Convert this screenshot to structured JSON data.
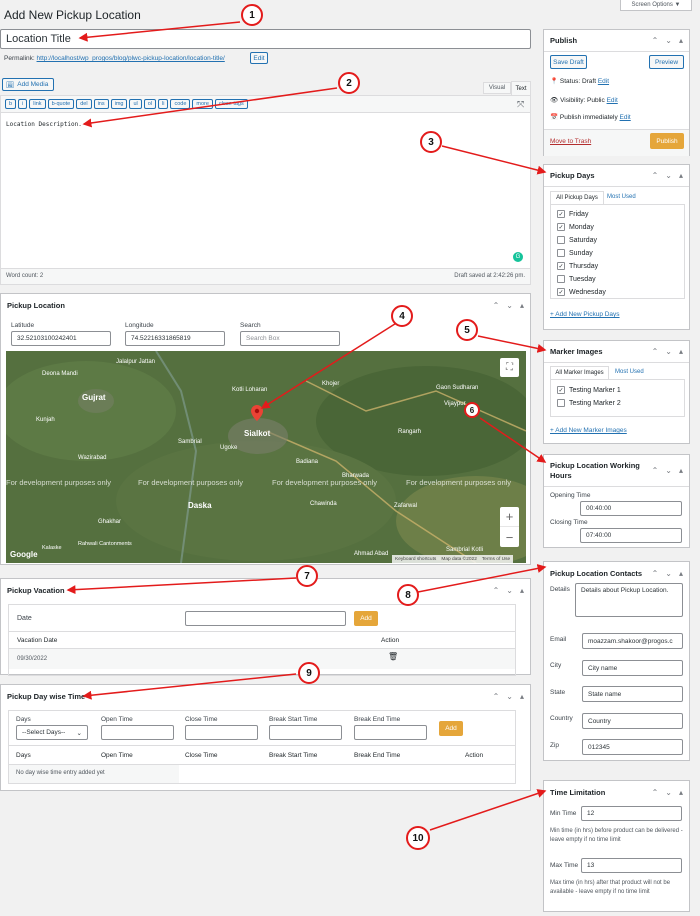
{
  "page": {
    "title": "Add New Pickup Location",
    "screen_options": "Screen Options ▼"
  },
  "editor": {
    "title_value": "Location Title",
    "permalink_label": "Permalink:",
    "permalink_url": "http://localhost/wp_progos/blog/plwc-pickup-location/location-title/",
    "permalink_edit": "Edit",
    "add_media": "Add Media",
    "tab_visual": "Visual",
    "tab_text": "Text",
    "quicktags": [
      "b",
      "i",
      "link",
      "b-quote",
      "del",
      "ins",
      "img",
      "ul",
      "ol",
      "li",
      "code",
      "more",
      "close tags"
    ],
    "content": "Location Description.",
    "word_count": "Word count: 2",
    "draft_saved": "Draft saved at 2:42:26 pm."
  },
  "publish": {
    "title": "Publish",
    "save_draft": "Save Draft",
    "preview": "Preview",
    "status": "Status: Draft",
    "status_edit": "Edit",
    "visibility": "Visibility: Public",
    "visibility_edit": "Edit",
    "publish_time": "Publish immediately",
    "publish_edit": "Edit",
    "trash": "Move to Trash",
    "publish_btn": "Publish"
  },
  "pickup_days": {
    "title": "Pickup Days",
    "tab_all": "All Pickup Days",
    "tab_used": "Most Used",
    "items": [
      {
        "label": "Friday",
        "checked": "✓"
      },
      {
        "label": "Monday",
        "checked": "✓"
      },
      {
        "label": "Saturday",
        "checked": ""
      },
      {
        "label": "Sunday",
        "checked": ""
      },
      {
        "label": "Thursday",
        "checked": "✓"
      },
      {
        "label": "Tuesday",
        "checked": ""
      },
      {
        "label": "Wednesday",
        "checked": "✓"
      }
    ],
    "add_new": "+ Add New Pickup Days"
  },
  "pickup_location": {
    "title": "Pickup Location",
    "latitude_label": "Latitude",
    "latitude_value": "32.52103100242401",
    "longitude_label": "Longitude",
    "longitude_value": "74.52216331865819",
    "search_label": "Search",
    "search_placeholder": "Search Box"
  },
  "map": {
    "places": [
      "Jalalpur Jattan",
      "Deona Mandi",
      "Gujrat",
      "Kunjah",
      "Sambrial",
      "Sialkot",
      "Ugoke",
      "Wazirabad",
      "Kotli Loharan",
      "Khojer",
      "Gaon Sudharan",
      "Vijaypur",
      "Rangarh",
      "Daska",
      "Ghakhar",
      "Rahwali Cantonments",
      "Kalaske",
      "Chawinda",
      "Zafarwal",
      "Badiana",
      "Bharwada",
      "Ahmad Abad",
      "Sambrial Kotli"
    ],
    "dev_text": "For development purposes only",
    "zoom_in": "+",
    "zoom_out": "−",
    "fullscreen": "⛶",
    "google": "Google",
    "footer": [
      "Keyboard shortcuts",
      "Map data ©2022",
      "Terms of Use"
    ]
  },
  "marker_images": {
    "title": "Marker Images",
    "tab_all": "All Marker Images",
    "tab_used": "Most Used",
    "items": [
      {
        "label": "Testing Marker 1",
        "checked": "✓"
      },
      {
        "label": "Testing Marker 2",
        "checked": ""
      }
    ],
    "add_new": "+ Add New Marker Images"
  },
  "working_hours": {
    "title": "Pickup Location Working Hours",
    "opening_label": "Opening Time",
    "opening_value": "00:40:00",
    "closing_label": "Closing Time",
    "closing_value": "07:40:00"
  },
  "vacation": {
    "title": "Pickup Vacation",
    "date_label": "Date",
    "add": "Add",
    "col_date": "Vacation Date",
    "col_action": "Action",
    "rows": [
      {
        "date": "09/30/2022"
      }
    ]
  },
  "contacts": {
    "title": "Pickup Location Contacts",
    "details_label": "Details",
    "details_value": "Details about Pickup Location.",
    "email_label": "Email",
    "email_value": "moazzam.shakoor@progos.c",
    "city_label": "City",
    "city_value": "City name",
    "state_label": "State",
    "state_value": "State name",
    "country_label": "Country",
    "country_value": "Country",
    "zip_label": "Zip",
    "zip_value": "012345"
  },
  "day_wise": {
    "title": "Pickup Day wise Time",
    "days_label": "Days",
    "days_select": "--Select Days--",
    "open_label": "Open Time",
    "close_label": "Close Time",
    "break_start_label": "Break Start Time",
    "break_end_label": "Break End Time",
    "add": "Add",
    "col_days": "Days",
    "col_open": "Open Time",
    "col_close": "Close Time",
    "col_bstart": "Break Start Time",
    "col_bend": "Break End Time",
    "col_action": "Action",
    "empty": "No day wise time entry added yet"
  },
  "time_limit": {
    "title": "Time Limitation",
    "min_label": "Min Time",
    "min_value": "12",
    "min_hint": "Min time (in hrs) before product can be delivered - leave empty if no time limit",
    "max_label": "Max Time",
    "max_value": "13",
    "max_hint": "Max time (in hrs) after that product will not be available - leave empty if no time limit"
  },
  "callouts": [
    "1",
    "2",
    "3",
    "4",
    "5",
    "6",
    "7",
    "8",
    "9",
    "10"
  ],
  "colors": {
    "accent": "#2271b1",
    "primary_btn": "#e5a63a",
    "callout": "#e31b1b"
  }
}
